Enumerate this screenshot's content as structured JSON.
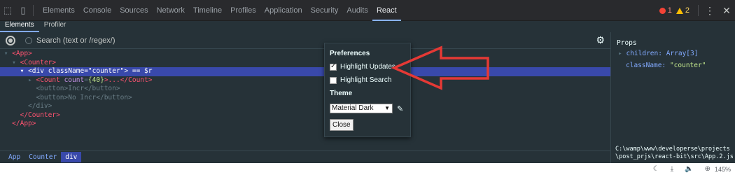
{
  "devtools": {
    "tabs": [
      "Elements",
      "Console",
      "Sources",
      "Network",
      "Timeline",
      "Profiles",
      "Application",
      "Security",
      "Audits",
      "React"
    ],
    "active_tab": "React",
    "error_count": "1",
    "warning_count": "2"
  },
  "react": {
    "subtabs": [
      "Elements",
      "Profiler"
    ],
    "search_placeholder": "Search (text or /regex/)"
  },
  "tree": {
    "r1_open": "<App>",
    "r2_open": "<Counter>",
    "r3_tagname": "<div",
    "r3_attrname": "className",
    "r3_attrval": "\"counter\"",
    "r3_close": ">",
    "r3_extra": "== $r",
    "r4_tag": "<Count",
    "r4_attr": "count",
    "r4_val": "{40}",
    "r4_rest": ">...</Count>",
    "r5": "<button>Incr</button>",
    "r6": "<button>No Incr</button>",
    "r7": "</div>",
    "r8": "</Counter>",
    "r9": "</App>"
  },
  "breadcrumb": [
    "App",
    "Counter",
    "div"
  ],
  "props": {
    "header": "Props",
    "children_key": "children",
    "children_val": "Array[3]",
    "class_key": "className",
    "class_val": "\"counter\"",
    "path": "C:\\wamp\\www\\developerse\\projects\\post_prjs\\react-bit\\src\\App.2.js"
  },
  "preferences": {
    "title": "Preferences",
    "highlight_updates": "Highlight Updates",
    "highlight_updates_checked": true,
    "highlight_search": "Highlight Search",
    "highlight_search_checked": false,
    "theme_label": "Theme",
    "theme_value": "Material Dark",
    "close_label": "Close"
  },
  "statusbar": {
    "zoom": "145%"
  },
  "colors": {
    "annotation_arrow": "#e53935",
    "selected_row": "#3949ab"
  }
}
